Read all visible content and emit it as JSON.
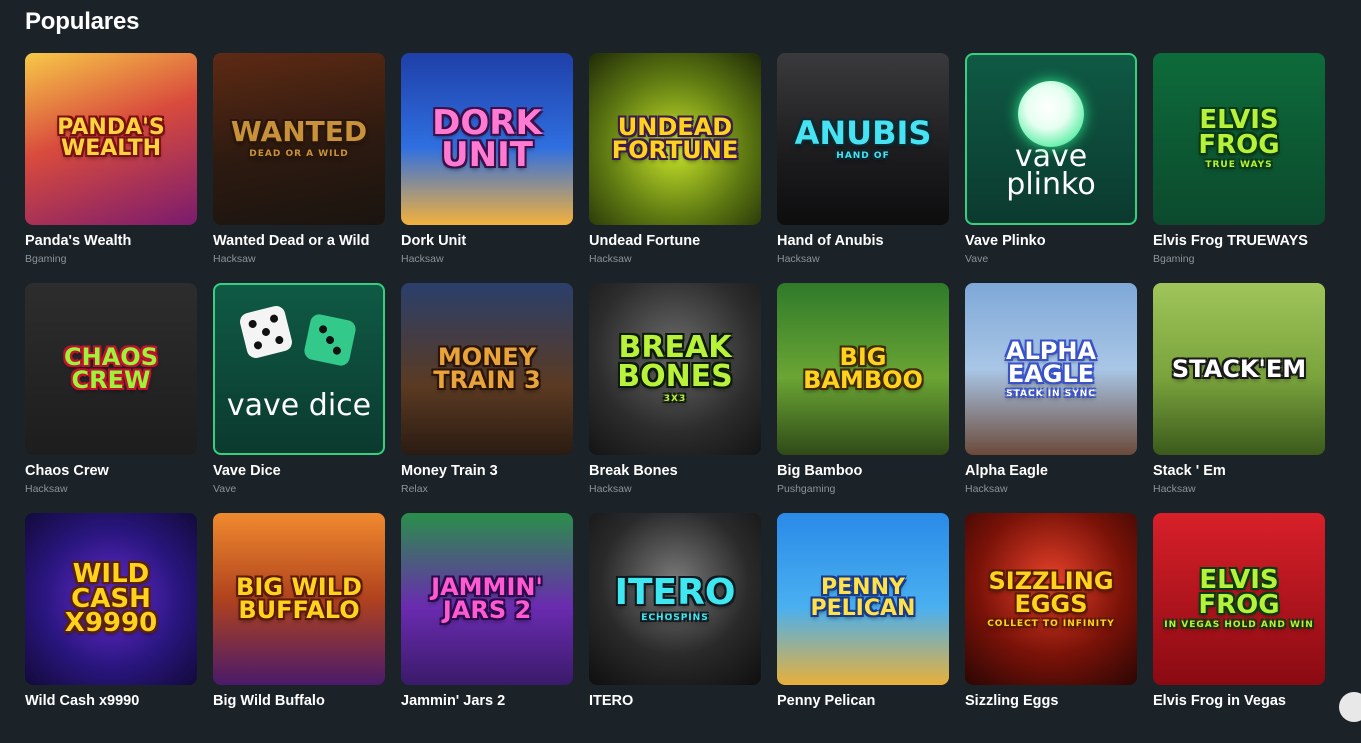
{
  "section": {
    "title": "Populares"
  },
  "games": [
    {
      "name": "Panda's Wealth",
      "provider": "Bgaming",
      "art": "Panda's Wealth",
      "art_sub": "",
      "bg": "linear-gradient(160deg,#f7c948 0%,#d94b3d 45%,#7a1b6e 100%)",
      "art_color": "#ffd23f",
      "art_stroke": "#7b1010",
      "art_size": 22,
      "outlined": false
    },
    {
      "name": "Wanted Dead or a Wild",
      "provider": "Hacksaw",
      "art": "Wanted",
      "art_sub": "Dead or a Wild",
      "bg": "linear-gradient(170deg,#5e2a14 0%,#2d1a10 55%,#1a1410 100%)",
      "art_color": "#c7923a",
      "art_stroke": "#2a160a",
      "art_size": 28,
      "outlined": false
    },
    {
      "name": "Dork Unit",
      "provider": "Hacksaw",
      "art": "Dork Unit",
      "art_sub": "",
      "bg": "linear-gradient(180deg,#1f3fa8 0%,#2f6fe0 55%,#f3b13c 100%)",
      "art_color": "#ff7ad1",
      "art_stroke": "#3a0f4a",
      "art_size": 34,
      "outlined": false
    },
    {
      "name": "Undead Fortune",
      "provider": "Hacksaw",
      "art": "Undead Fortune",
      "art_sub": "",
      "bg": "radial-gradient(circle at 50% 55%,#c8e52a 0%,#5f7a12 55%,#1f2a08 100%)",
      "art_color": "#ffd21e",
      "art_stroke": "#3a1a52",
      "art_size": 24,
      "outlined": false
    },
    {
      "name": "Hand of Anubis",
      "provider": "Hacksaw",
      "art": "Anubis",
      "art_sub": "Hand of",
      "bg": "linear-gradient(180deg,#3a3a3c 0%,#1c1c1e 60%,#0d0d0e 100%)",
      "art_color": "#48e3f2",
      "art_stroke": "#0a2a33",
      "art_size": 32,
      "outlined": false
    },
    {
      "name": "Vave Plinko",
      "provider": "Vave",
      "art": "vave plinko",
      "art_sub": "",
      "bg": "linear-gradient(180deg,#0f5a44 0%,#0b3a2e 100%)",
      "art_color": "#ffffff",
      "art_stroke": "",
      "art_size": 30,
      "outlined": true,
      "kind": "plinko"
    },
    {
      "name": "Elvis Frog TRUEWAYS",
      "provider": "Bgaming",
      "art": "Elvis Frog",
      "art_sub": "True Ways",
      "bg": "linear-gradient(180deg,#0d6b3a 0%,#0c4a2e 100%)",
      "art_color": "#b6f23a",
      "art_stroke": "#0b3a12",
      "art_size": 26,
      "outlined": false
    },
    {
      "name": "Chaos Crew",
      "provider": "Hacksaw",
      "art": "Chaos Crew",
      "art_sub": "",
      "bg": "linear-gradient(180deg,#2d2d2d 0%,#1d1d1d 100%)",
      "art_color": "#9df23a",
      "art_stroke": "#c0122f",
      "art_size": 24,
      "outlined": false
    },
    {
      "name": "Vave Dice",
      "provider": "Vave",
      "art": "vave dice",
      "art_sub": "",
      "bg": "linear-gradient(180deg,#0f5a44 0%,#0b3a2e 100%)",
      "art_color": "#ffffff",
      "art_stroke": "",
      "art_size": 30,
      "outlined": true,
      "kind": "dice"
    },
    {
      "name": "Money Train 3",
      "provider": "Relax",
      "art": "Money Train 3",
      "art_sub": "",
      "bg": "linear-gradient(180deg,#2a3f6b 0%,#5b3a22 60%,#2a1b12 100%)",
      "art_color": "#e8a33b",
      "art_stroke": "#2a1406",
      "art_size": 24,
      "outlined": false
    },
    {
      "name": "Break Bones",
      "provider": "Hacksaw",
      "art": "Break Bones",
      "art_sub": "3x3",
      "bg": "radial-gradient(circle at 50% 40%,#6a6a6a 0%,#2c2c2c 60%,#141414 100%)",
      "art_color": "#b8f23a",
      "art_stroke": "#0d1a04",
      "art_size": 30,
      "outlined": false
    },
    {
      "name": "Big Bamboo",
      "provider": "Pushgaming",
      "art": "Big Bamboo",
      "art_sub": "",
      "bg": "linear-gradient(180deg,#2f7a2a 0%,#6ba534 55%,#2f4a18 100%)",
      "art_color": "#ffd21e",
      "art_stroke": "#3f2a06",
      "art_size": 24,
      "outlined": false
    },
    {
      "name": "Alpha Eagle",
      "provider": "Hacksaw",
      "art": "Alpha Eagle",
      "art_sub": "stack in sync",
      "bg": "linear-gradient(180deg,#7fa8d8 0%,#a9c6e6 50%,#6b4a3a 100%)",
      "art_color": "#ffffff",
      "art_stroke": "#3a52c8",
      "art_size": 24,
      "outlined": false
    },
    {
      "name": "Stack ' Em",
      "provider": "Hacksaw",
      "art": "Stack'em",
      "art_sub": "",
      "bg": "linear-gradient(180deg,#9fc55a 0%,#7aa33c 55%,#3b5a1c 100%)",
      "art_color": "#ffffff",
      "art_stroke": "#1a1a1a",
      "art_size": 24,
      "outlined": false
    },
    {
      "name": "Wild Cash x9990",
      "provider": "",
      "art": "Wild Cash x9990",
      "art_sub": "",
      "bg": "radial-gradient(circle at 50% 50%,#6a2bd0 0%,#2a1680 55%,#120a3a 100%)",
      "art_color": "#ffd21e",
      "art_stroke": "#5a2300",
      "art_size": 26,
      "outlined": false
    },
    {
      "name": "Big Wild Buffalo",
      "provider": "",
      "art": "Big Wild Buffalo",
      "art_sub": "",
      "bg": "linear-gradient(180deg,#f08a2e 0%,#b0421e 50%,#4a1a6a 100%)",
      "art_color": "#ffd21e",
      "art_stroke": "#5a1a06",
      "art_size": 24,
      "outlined": false
    },
    {
      "name": "Jammin' Jars 2",
      "provider": "",
      "art": "Jammin' Jars 2",
      "art_sub": "",
      "bg": "linear-gradient(180deg,#2a8f4a 0%,#6a2bb0 55%,#3a1a6a 100%)",
      "art_color": "#ff5ad1",
      "art_stroke": "#2a0a4a",
      "art_size": 24,
      "outlined": false
    },
    {
      "name": "ITERO",
      "provider": "",
      "art": "Itero",
      "art_sub": "EchoSpins",
      "bg": "radial-gradient(circle at 50% 40%,#7a7a7a 0%,#2a2a2a 55%,#0f0f0f 100%)",
      "art_color": "#3fe8f0",
      "art_stroke": "#0a1a20",
      "art_size": 36,
      "outlined": false
    },
    {
      "name": "Penny Pelican",
      "provider": "",
      "art": "Penny Pelican",
      "art_sub": "",
      "bg": "linear-gradient(180deg,#2a8ae8 0%,#4ab0f0 55%,#e8b03a 100%)",
      "art_color": "#ffe14a",
      "art_stroke": "#1a3a8a",
      "art_size": 22,
      "outlined": false
    },
    {
      "name": "Sizzling Eggs",
      "provider": "",
      "art": "Sizzling Eggs",
      "art_sub": "Collect to Infinity",
      "bg": "radial-gradient(circle at 50% 40%,#e8422a 0%,#7a1208 55%,#2a0604 100%)",
      "art_color": "#ffd21e",
      "art_stroke": "#5a1a02",
      "art_size": 24,
      "outlined": false
    },
    {
      "name": "Elvis Frog in Vegas",
      "provider": "",
      "art": "Elvis Frog",
      "art_sub": "In Vegas Hold and Win",
      "bg": "linear-gradient(180deg,#d8202a 0%,#8a0a12 100%)",
      "art_color": "#b6f23a",
      "art_stroke": "#0b3a12",
      "art_size": 26,
      "outlined": false
    }
  ]
}
